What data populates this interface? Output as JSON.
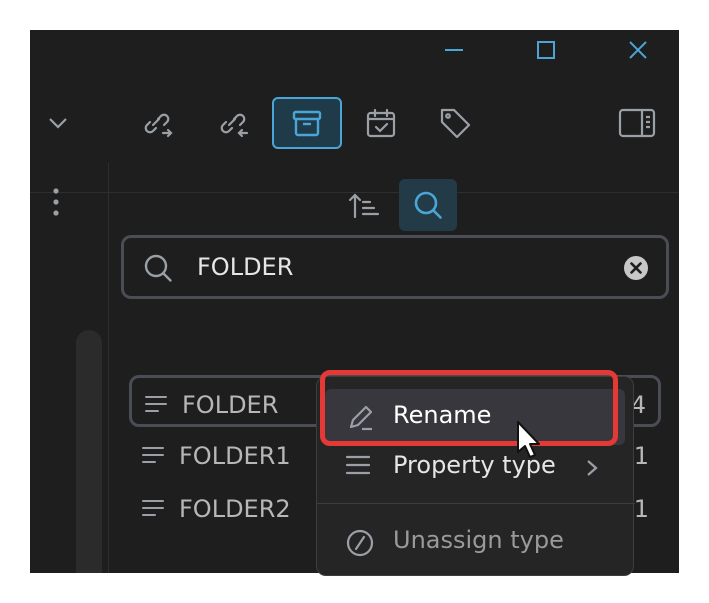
{
  "window": {
    "controls": {
      "minimize": "minimize-icon",
      "maximize": "maximize-icon",
      "close": "close-icon"
    }
  },
  "toolbar": {
    "icons": [
      "outgoing-links-icon",
      "backlinks-icon",
      "archive-icon",
      "calendar-icon",
      "tags-icon",
      "right-sidebar-toggle-icon"
    ],
    "active": "archive-icon"
  },
  "panel": {
    "sort_icon": "sort-icon",
    "search_toggle_icon": "search-icon"
  },
  "search": {
    "query": "FOLDER"
  },
  "properties": [
    {
      "name": "FOLDER",
      "count": "4"
    },
    {
      "name": "FOLDER1",
      "count": "1"
    },
    {
      "name": "FOLDER2",
      "count": "1"
    }
  ],
  "context_menu": {
    "rename": "Rename",
    "property_type": "Property type",
    "unassign": "Unassign type"
  },
  "colors": {
    "background": "#1e1e1e",
    "accent": "#4aa6d6",
    "highlight": "#e53935"
  }
}
